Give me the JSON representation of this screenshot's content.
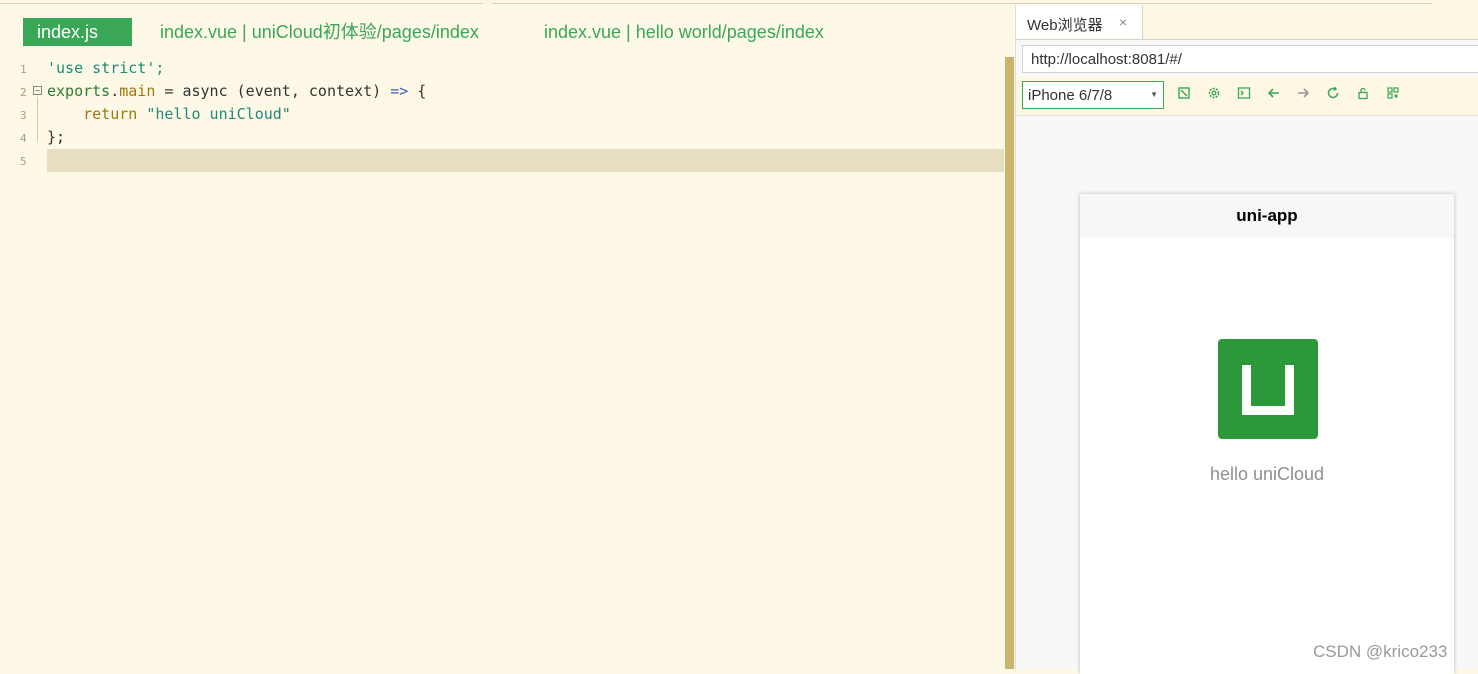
{
  "editor": {
    "tabs": [
      {
        "label": "index.js",
        "active": true
      },
      {
        "label": "index.vue | uniCloud初体验/pages/index",
        "active": false
      },
      {
        "label": "index.vue | hello world/pages/index",
        "active": false
      }
    ],
    "line_numbers": [
      "1",
      "2",
      "3",
      "4",
      "5"
    ],
    "code": {
      "l1_str": "'use strict';",
      "l2_obj": "exports",
      "l2_dot": ".",
      "l2_main": "main",
      "l2_eq": " = ",
      "l2_async": "async",
      "l2_params": " (event, context) ",
      "l2_arrow": "=>",
      "l2_brace": " {",
      "l3_indent": "    ",
      "l3_return": "return",
      "l3_sp": " ",
      "l3_str": "\"hello uniCloud\"",
      "l4_close": "};"
    }
  },
  "browser": {
    "tab_label": "Web浏览器",
    "tab_close": "×",
    "url": "http://localhost:8081/#/",
    "device": "iPhone 6/7/8",
    "toolbar_icons": [
      "rotate-icon",
      "settings-icon",
      "console-icon",
      "back-arrow-icon",
      "forward-arrow-icon",
      "reload-icon",
      "lock-icon",
      "qrcode-icon"
    ],
    "page": {
      "nav_title": "uni-app",
      "logo_color": "#2b9939",
      "message": "hello uniCloud"
    }
  },
  "watermark": "CSDN @krico233",
  "colors": {
    "accent": "#3aa757",
    "editor_bg": "#fef9e7"
  }
}
